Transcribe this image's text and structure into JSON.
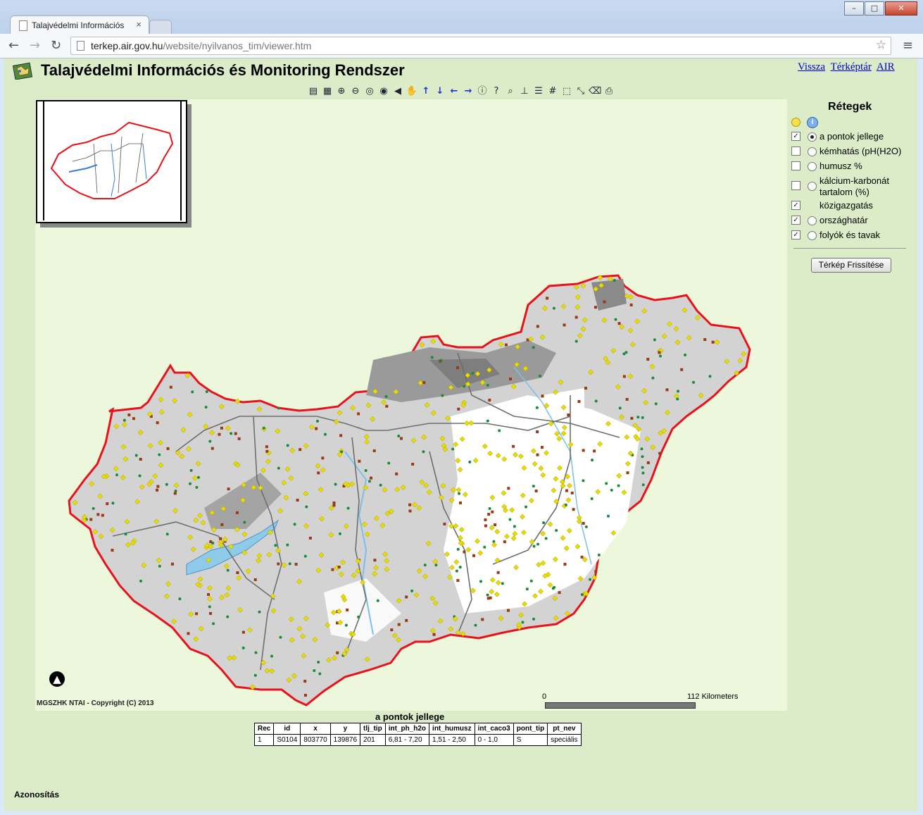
{
  "browser": {
    "tab_title": "Talajvédelmi Információs",
    "tab_close": "×",
    "url_domain": "terkep.air.gov.hu",
    "url_path": "/website/nyilvanos_tim/viewer.htm"
  },
  "header": {
    "title": "Talajvédelmi Információs és Monitoring Rendszer",
    "links": [
      "Vissza",
      "Térképtár",
      "AIR"
    ]
  },
  "toolbar": {
    "icons": [
      "toc-icon",
      "legend-icon",
      "zoom-in-icon",
      "zoom-out-icon",
      "full-extent-icon",
      "zoom-active-icon",
      "previous-extent-icon",
      "pan-icon",
      "pan-north-icon",
      "pan-south-icon",
      "pan-west-icon",
      "pan-east-icon",
      "identify-icon",
      "query-icon",
      "find-icon",
      "measure-icon",
      "set-units-icon",
      "buffer-icon",
      "select-rectangle-icon",
      "select-by-line-icon",
      "clear-selection-icon",
      "print-icon"
    ]
  },
  "map": {
    "copyright": "MGSZHK NTAI - Copyright (C) 2013",
    "scale_start": "0",
    "scale_end": "112 Kilometers",
    "north_arrow": "▲"
  },
  "layers": {
    "title": "Rétegek",
    "items": [
      {
        "label": "a pontok jellege",
        "checked": true,
        "radio": true,
        "active": true
      },
      {
        "label": "kémhatás (pH(H2O)",
        "checked": false,
        "radio": true,
        "active": false
      },
      {
        "label": "humusz %",
        "checked": false,
        "radio": true,
        "active": false
      },
      {
        "label": "kálcium-karbonát tartalom (%)",
        "label_line2": "tartalom (%)",
        "checked": false,
        "radio": true,
        "active": false
      },
      {
        "label": "közigazgatás",
        "checked": true,
        "radio": false,
        "active": false
      },
      {
        "label": "országhatár",
        "checked": true,
        "radio": true,
        "active": false
      },
      {
        "label": "folyók és tavak",
        "checked": true,
        "radio": true,
        "active": false
      }
    ],
    "refresh_label": "Térkép Frissítése"
  },
  "results": {
    "title": "a pontok jellege",
    "columns": [
      "Rec",
      "id",
      "x",
      "y",
      "tlj_tip",
      "int_ph_h2o",
      "int_humusz",
      "int_caco3",
      "pont_tip",
      "pt_nev"
    ],
    "rows": [
      [
        "1",
        "S0104",
        "803770",
        "139876",
        "201",
        "6,81 - 7,20",
        "1,51 - 2,50",
        "0 - 1,0",
        "S",
        "speciális"
      ]
    ]
  },
  "footer": {
    "label": "Azonosítás"
  },
  "colors": {
    "page_bg": "#dcecc8",
    "map_bg": "#edf7db",
    "border_red": "#e8121a",
    "link_blue": "#0000cc",
    "point_yellow": "#e8dc00",
    "point_brown": "#9a3a10",
    "point_green": "#1a8a3a"
  }
}
